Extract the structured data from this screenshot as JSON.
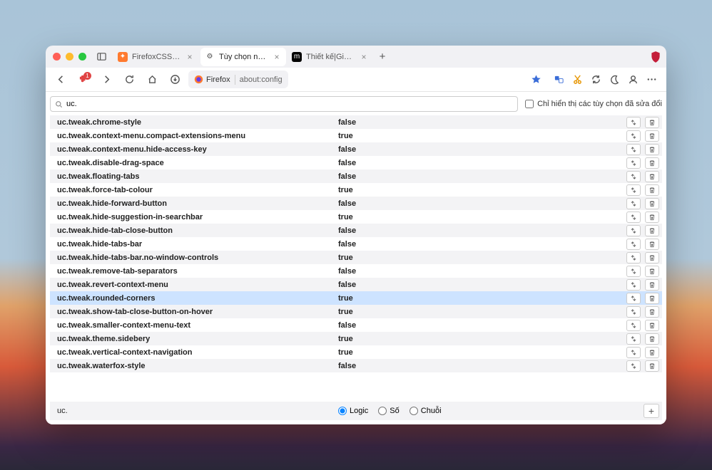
{
  "tabs": [
    {
      "title": "FirefoxCSS Store",
      "favicon_bg": "#ff7a2f",
      "favicon_glyph": "✦"
    },
    {
      "title": "Tùy chọn nâng cao",
      "favicon_bg": "#fff",
      "favicon_glyph": "⚙"
    },
    {
      "title": "Thiết kế|Giao diện Tab - Mozil…",
      "favicon_bg": "#000",
      "favicon_glyph": "m"
    }
  ],
  "active_tab_index": 1,
  "urlbar": {
    "identity_label": "Firefox",
    "url": "about:config"
  },
  "ext_badge": "1",
  "search": {
    "value": "uc.",
    "modified_only_label": "Chỉ hiển thị các tùy chọn đã sửa đổi",
    "modified_only_checked": false
  },
  "prefs": [
    {
      "name": "uc.tweak.chrome-style",
      "value": "false"
    },
    {
      "name": "uc.tweak.context-menu.compact-extensions-menu",
      "value": "true"
    },
    {
      "name": "uc.tweak.context-menu.hide-access-key",
      "value": "false"
    },
    {
      "name": "uc.tweak.disable-drag-space",
      "value": "false"
    },
    {
      "name": "uc.tweak.floating-tabs",
      "value": "false"
    },
    {
      "name": "uc.tweak.force-tab-colour",
      "value": "true"
    },
    {
      "name": "uc.tweak.hide-forward-button",
      "value": "false"
    },
    {
      "name": "uc.tweak.hide-suggestion-in-searchbar",
      "value": "true"
    },
    {
      "name": "uc.tweak.hide-tab-close-button",
      "value": "false"
    },
    {
      "name": "uc.tweak.hide-tabs-bar",
      "value": "false"
    },
    {
      "name": "uc.tweak.hide-tabs-bar.no-window-controls",
      "value": "true"
    },
    {
      "name": "uc.tweak.remove-tab-separators",
      "value": "false"
    },
    {
      "name": "uc.tweak.revert-context-menu",
      "value": "false"
    },
    {
      "name": "uc.tweak.rounded-corners",
      "value": "true",
      "highlighted": true
    },
    {
      "name": "uc.tweak.show-tab-close-button-on-hover",
      "value": "true"
    },
    {
      "name": "uc.tweak.smaller-context-menu-text",
      "value": "false"
    },
    {
      "name": "uc.tweak.theme.sidebery",
      "value": "true"
    },
    {
      "name": "uc.tweak.vertical-context-navigation",
      "value": "true"
    },
    {
      "name": "uc.tweak.waterfox-style",
      "value": "false"
    }
  ],
  "new_pref": {
    "name": "uc.",
    "type_options": [
      {
        "label": "Logic",
        "checked": true
      },
      {
        "label": "Số",
        "checked": false
      },
      {
        "label": "Chuỗi",
        "checked": false
      }
    ]
  }
}
